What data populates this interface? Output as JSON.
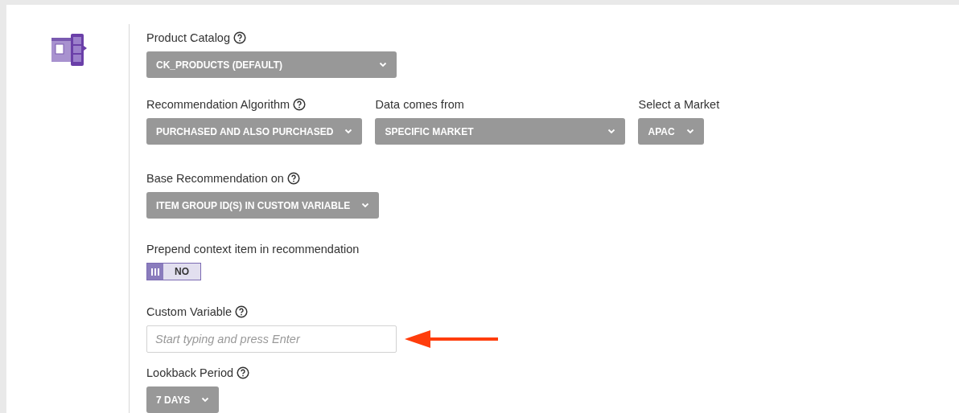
{
  "rows": [
    {
      "fields": [
        {
          "kind": "select",
          "label": "Product Catalog",
          "help": true,
          "value": "CK_PRODUCTS (DEFAULT)"
        }
      ]
    },
    {
      "fields": [
        {
          "kind": "select",
          "label": "Recommendation Algorithm",
          "help": true,
          "value": "PURCHASED AND ALSO PURCHASED"
        },
        {
          "kind": "select",
          "label": "Data comes from",
          "help": false,
          "value": "SPECIFIC MARKET"
        },
        {
          "kind": "select",
          "label": "Select a Market",
          "help": false,
          "value": "APAC"
        }
      ]
    },
    {
      "fields": [
        {
          "kind": "select",
          "label": "Base Recommendation on",
          "help": true,
          "value": "ITEM GROUP ID(S) IN CUSTOM VARIABLE"
        }
      ]
    },
    {
      "fields": [
        {
          "kind": "toggle",
          "label": "Prepend context item in recommendation",
          "help": false,
          "on": false,
          "value": "NO"
        }
      ]
    },
    {
      "fields": [
        {
          "kind": "text",
          "label": "Custom Variable",
          "help": true,
          "placeholder": "Start typing and press Enter",
          "pointer": true
        }
      ]
    },
    {
      "fields": [
        {
          "kind": "select",
          "label": "Lookback Period",
          "help": true,
          "value": "7 DAYS"
        }
      ]
    }
  ]
}
